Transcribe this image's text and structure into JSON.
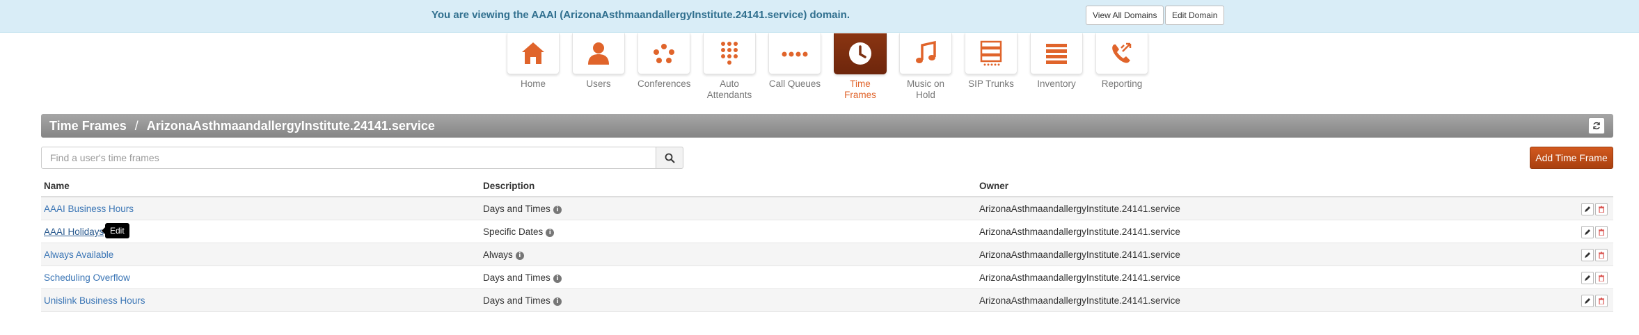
{
  "banner": {
    "message": "You are viewing the AAAI (ArizonaAsthmaandallergyInstitute.24141.service) domain.",
    "view_all_label": "View All Domains",
    "edit_domain_label": "Edit Domain"
  },
  "nav": {
    "items": [
      {
        "label": "Home",
        "icon": "home-icon"
      },
      {
        "label": "Users",
        "icon": "user-icon"
      },
      {
        "label": "Conferences",
        "icon": "conference-icon"
      },
      {
        "label": "Auto Attendants",
        "icon": "keypad-icon"
      },
      {
        "label": "Call Queues",
        "icon": "dots-icon"
      },
      {
        "label": "Time Frames",
        "icon": "clock-icon",
        "active": true
      },
      {
        "label": "Music on Hold",
        "icon": "music-note-icon"
      },
      {
        "label": "SIP Trunks",
        "icon": "server-icon"
      },
      {
        "label": "Inventory",
        "icon": "list-icon"
      },
      {
        "label": "Reporting",
        "icon": "phone-arrows-icon"
      }
    ],
    "accent": "#e0642b"
  },
  "header": {
    "section": "Time Frames",
    "separator": "/",
    "domain": "ArizonaAsthmaandallergyInstitute.24141.service"
  },
  "search": {
    "placeholder": "Find a user's time frames"
  },
  "add_button_label": "Add Time Frame",
  "table": {
    "columns": [
      "Name",
      "Description",
      "Owner"
    ],
    "rows": [
      {
        "name": "AAAI Business Hours",
        "description": "Days and Times",
        "owner": "ArizonaAsthmaandallergyInstitute.24141.service"
      },
      {
        "name": "AAAI Holidays",
        "description": "Specific Dates",
        "owner": "ArizonaAsthmaandallergyInstitute.24141.service"
      },
      {
        "name": "Always Available",
        "description": "Always",
        "owner": "ArizonaAsthmaandallergyInstitute.24141.service"
      },
      {
        "name": "Scheduling Overflow",
        "description": "Days and Times",
        "owner": "ArizonaAsthmaandallergyInstitute.24141.service"
      },
      {
        "name": "Unislink Business Hours",
        "description": "Days and Times",
        "owner": "ArizonaAsthmaandallergyInstitute.24141.service"
      }
    ],
    "tooltip": "Edit"
  }
}
